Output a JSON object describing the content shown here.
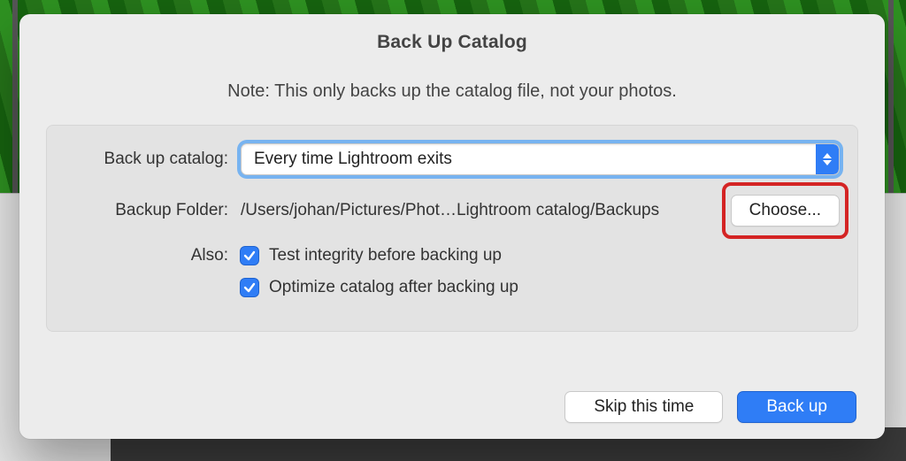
{
  "dialog": {
    "title": "Back Up Catalog",
    "note": "Note: This only backs up the catalog file, not your photos."
  },
  "form": {
    "backup_catalog_label": "Back up catalog:",
    "backup_catalog_value": "Every time Lightroom exits",
    "backup_folder_label": "Backup Folder:",
    "backup_folder_path": "/Users/johan/Pictures/Phot…Lightroom catalog/Backups",
    "choose_label": "Choose...",
    "also_label": "Also:",
    "cb_integrity_label": "Test integrity before backing up",
    "cb_integrity_checked": true,
    "cb_optimize_label": "Optimize catalog after backing up",
    "cb_optimize_checked": true
  },
  "footer": {
    "skip_label": "Skip this time",
    "backup_label": "Back up"
  }
}
